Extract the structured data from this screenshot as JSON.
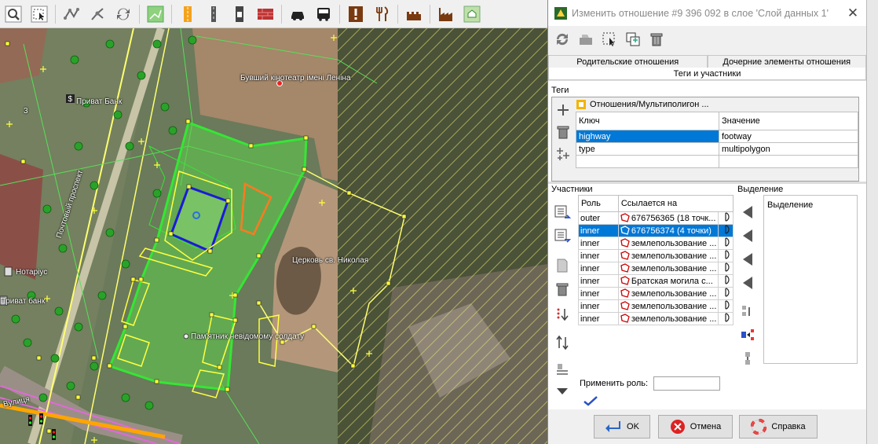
{
  "toolbar": {
    "icons": [
      "zoom-icon",
      "select-icon",
      "nodes-icon",
      "split-icon",
      "refresh-icon",
      "landuse-icon",
      "highway-icon",
      "railway-icon",
      "waterway-icon",
      "building-icon",
      "car-icon",
      "bus-icon",
      "poi-icon",
      "food-icon",
      "castle-icon",
      "industry-icon",
      "settlement-icon"
    ]
  },
  "map": {
    "labels": {
      "cinema": "Бувший кінотеатр імені Леніна",
      "bank1": "Приват Банк",
      "house_no": "3",
      "notary": "Нотаріус",
      "bank2": "Приват банк",
      "avenue": "Почтовый проспект",
      "church": "Церковь св. Николая",
      "monument": "Пам'ятник невідомому солдату",
      "street": "Вулиця"
    }
  },
  "dialog": {
    "title": "Изменить отношение #9 396 092 в слое 'Слой данных 1'",
    "close": "✕",
    "tabs": {
      "parent": "Родительские отношения",
      "children": "Дочерние элементы отношения",
      "tags_members": "Теги и участники"
    },
    "tags": {
      "group_label": "Теги",
      "preset": "Отношения/Мультиполигон ...",
      "col_key": "Ключ",
      "col_value": "Значение",
      "rows": [
        {
          "key": "highway",
          "value": "footway"
        },
        {
          "key": "type",
          "value": "multipolygon"
        }
      ]
    },
    "members": {
      "group_label": "Участники",
      "col_role": "Роль",
      "col_ref": "Ссылается на",
      "rows": [
        {
          "role": "outer",
          "ref": "676756365 (18 точк..."
        },
        {
          "role": "inner",
          "ref": "676756374 (4 точки)"
        },
        {
          "role": "inner",
          "ref": "землепользование ..."
        },
        {
          "role": "inner",
          "ref": "землепользование ..."
        },
        {
          "role": "inner",
          "ref": "землепользование ..."
        },
        {
          "role": "inner",
          "ref": "Братская могила с..."
        },
        {
          "role": "inner",
          "ref": "землепользование ..."
        },
        {
          "role": "inner",
          "ref": "землепользование ..."
        },
        {
          "role": "inner",
          "ref": "землепользование ..."
        }
      ],
      "apply_role": "Применить роль:"
    },
    "selection": {
      "group_label": "Выделение",
      "header": "Выделение"
    },
    "buttons": {
      "ok": "OK",
      "cancel": "Отмена",
      "help": "Справка"
    }
  },
  "colors": {
    "selection_blue": "#0078d7",
    "highlight_green": "#35e635",
    "vertex_yellow": "#ffff40"
  }
}
